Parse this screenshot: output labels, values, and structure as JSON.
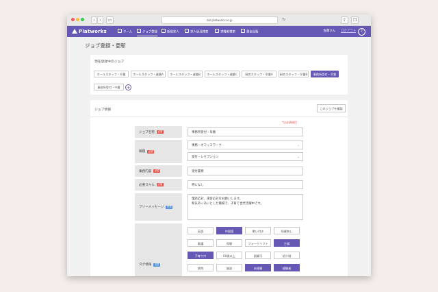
{
  "browser": {
    "url": "biz.platworks.co.jp",
    "back": "‹",
    "forward": "›"
  },
  "nav": {
    "logo": "Platworks",
    "items": [
      "ホーム",
      "ジョブ登録",
      "新規求人",
      "求人状況検索",
      "求職者検索",
      "資金自販"
    ],
    "user": "佐藤さん",
    "logout": "ログアウト",
    "help": "?"
  },
  "page": {
    "title": "ジョブ登録・更新"
  },
  "jobs_card": {
    "title": "現在登録中のジョブ",
    "jobs": [
      "ホールスタッフ・早番",
      "ホールスタッフ・遅番A",
      "ホールスタッフ・遅番B",
      "ホールスタッフ・遅番C",
      "厨房スタッフ・早番A",
      "厨房スタッフ・早番B",
      "事務所受付・早番",
      "事務所受付・中番"
    ],
    "selected_index": 6,
    "add": "+"
  },
  "form_card": {
    "title": "ジョブ情報",
    "copy_button": "このジョブを複製",
    "required_note": "*は必須項目",
    "required_badge": "必須",
    "optional_badge": "任意",
    "fields": {
      "job_name": {
        "label": "ジョブ名称",
        "value": "事務所受付・早番"
      },
      "occupation": {
        "label": "職種",
        "value1": "事務・オフィスワーク",
        "value2": "受付・レセプション"
      },
      "work": {
        "label": "業務内容",
        "value": "受付業務"
      },
      "skills": {
        "label": "必要スキル",
        "value": "特になし"
      },
      "message": {
        "label": "フリーメッセージ",
        "line1": "電話応対、来客応対をお願いします。",
        "line2": "和気あいあいとした職場で、子育て世代活躍中です。"
      },
      "tags": {
        "label": "タグ情報"
      }
    },
    "tags": [
      {
        "label": "英語",
        "selected": false
      },
      {
        "label": "中国語",
        "selected": true
      },
      {
        "label": "賄い付き",
        "selected": false
      },
      {
        "label": "残業無し",
        "selected": false
      },
      {
        "label": "看護",
        "selected": false
      },
      {
        "label": "保健",
        "selected": false
      },
      {
        "label": "フォークリフト",
        "selected": false
      },
      {
        "label": "主婦",
        "selected": true
      },
      {
        "label": "子育て中",
        "selected": true
      },
      {
        "label": "60歳以上",
        "selected": false
      },
      {
        "label": "副業可",
        "selected": false
      },
      {
        "label": "紹介制",
        "selected": false
      },
      {
        "label": "病院",
        "selected": false
      },
      {
        "label": "施設",
        "selected": false
      },
      {
        "label": "未経験",
        "selected": true
      },
      {
        "label": "経験者",
        "selected": true
      }
    ]
  },
  "colors": {
    "accent": "#6559b5",
    "required": "#e8514a",
    "optional": "#4a90d9"
  }
}
